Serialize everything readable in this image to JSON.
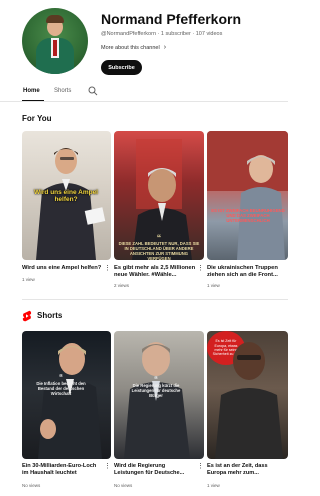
{
  "channel": {
    "name": "Normand Pfefferkorn",
    "meta": "@NormandPfefferkorn · 1 subscriber · 107 videos",
    "more_about": "More about this channel",
    "subscribe_label": "Subscribe"
  },
  "tabs": [
    {
      "label": "Home",
      "selected": true
    },
    {
      "label": "Shorts",
      "selected": false
    }
  ],
  "sections": {
    "for_you": "For You",
    "shorts": "Shorts"
  },
  "videos": [
    {
      "title": "Wird uns eine Ampel helfen?",
      "meta": "1 view",
      "caption": "Wird uns eine Ampel helfen?"
    },
    {
      "title": "Es gibt mehr als 2,5 Millionen neue Wähler. #Wähle...",
      "meta": "2 views",
      "caption": "DIESE ZAHL BEDEUTET NUR, DASS SIE IN DEUTSCHLAND ÜBER ANDERE ANSICHTEN ZUR STIMMUNG VERFÜGEN"
    },
    {
      "title": "Die ukrainischen Truppen ziehen sich an die Front...",
      "meta": "1 view",
      "caption": "ES IST ZWEIFACH BEUNRUHIGEND UND DAS ZWEIFACH UNTERMENSCHLICH"
    }
  ],
  "shorts": [
    {
      "title": "Ein 30-Milliarden-Euro-Loch im Haushalt leuchtet",
      "meta": "No views",
      "caption": "Die Inflation bedroht den Bestand der deutschen Wirtschaft"
    },
    {
      "title": "Wird die Regierung Leistungen für Deutsche...",
      "meta": "No views",
      "caption": "Die Regierung kürzt die Leistungen für deutsche Bürger"
    },
    {
      "title": "Es ist an der Zeit, dass Europa mehr zum...",
      "meta": "1 view",
      "caption": "Es ist Zeit für Europa, etwas mehr für seine Sicherheit zu tun"
    }
  ],
  "colors": {
    "accent": "#0f0f0f",
    "shorts_red": "#ff0000",
    "meta_gray": "#606060"
  }
}
